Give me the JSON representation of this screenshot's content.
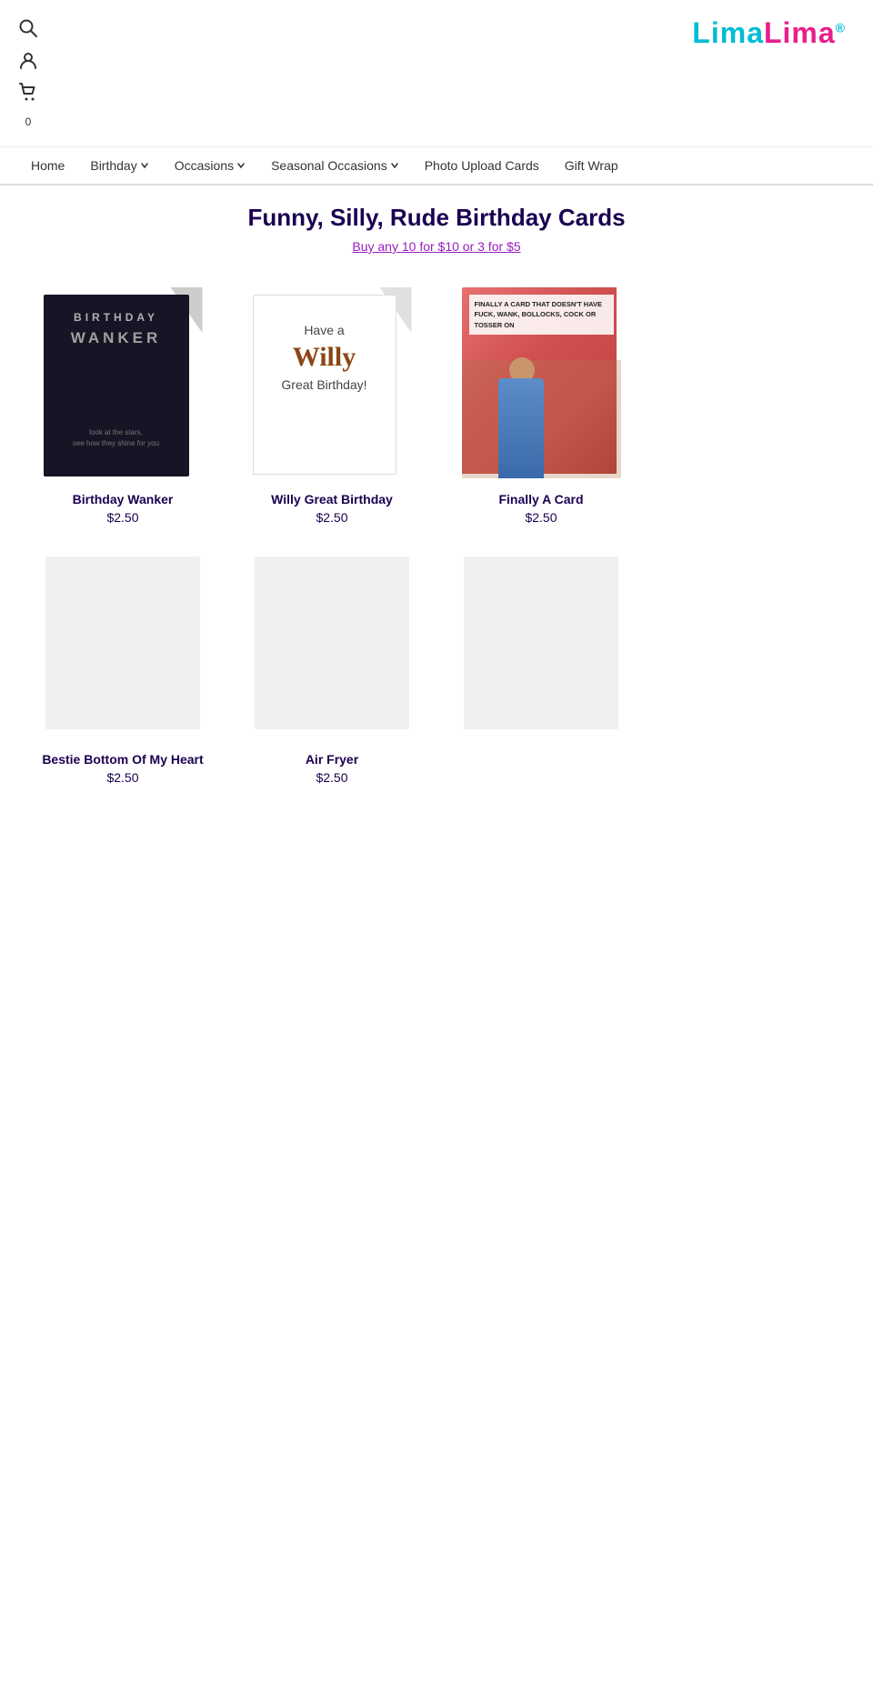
{
  "logo": {
    "part1": "Lima",
    "part2": "Lima",
    "reg": "®"
  },
  "header": {
    "cart_count": "0"
  },
  "nav": {
    "items": [
      {
        "label": "Home",
        "active": false,
        "has_dropdown": false
      },
      {
        "label": "Birthday",
        "active": false,
        "has_dropdown": true
      },
      {
        "label": "Occasions",
        "active": false,
        "has_dropdown": true
      },
      {
        "label": "Seasonal Occasions",
        "active": false,
        "has_dropdown": true
      },
      {
        "label": "Photo Upload Cards",
        "active": false,
        "has_dropdown": false
      },
      {
        "label": "Gift Wrap",
        "active": false,
        "has_dropdown": false
      }
    ]
  },
  "page": {
    "title": "Funny, Silly, Rude Birthday Cards",
    "promo_text": "Buy any 10 for $10 or 3 for $5"
  },
  "products": [
    {
      "name": "Birthday Wanker",
      "price": "$2.50",
      "type": "birthday-wanker",
      "card_text1": "BIRTHDAY",
      "card_text2": "WANKER",
      "card_subtext": "look at the stars, see how they shine for you"
    },
    {
      "name": "Willy Great Birthday",
      "price": "$2.50",
      "type": "willy",
      "card_have": "Have a",
      "card_willy": "Willy",
      "card_great": "Great Birthday!"
    },
    {
      "name": "Finally A Card",
      "price": "$2.50",
      "type": "finally",
      "card_text": "FINALLY A CARD THAT DOESN'T HAVE FUCK, WANK, BOLLOCKS, COCK OR TOSSER ON"
    },
    {
      "name": "Bestie Bottom Of My Heart",
      "price": "$2.50",
      "type": "placeholder"
    },
    {
      "name": "Air Fryer",
      "price": "$2.50",
      "type": "placeholder"
    },
    {
      "name": "",
      "price": "",
      "type": "placeholder-empty"
    }
  ]
}
